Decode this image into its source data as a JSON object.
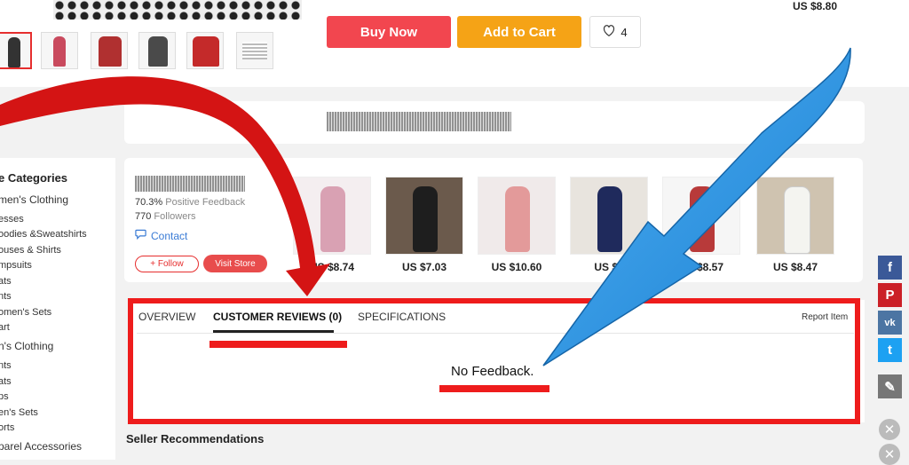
{
  "product": {
    "buy_label": "Buy Now",
    "cart_label": "Add to Cart",
    "wish_count": "4",
    "price_top": "US $8.80"
  },
  "sidebar": {
    "title": "e Categories",
    "groups": [
      {
        "head": "men's Clothing",
        "items": [
          "esses",
          "oodies &Sweatshirts",
          "ouses & Shirts",
          "mpsuits",
          "ats",
          "nts",
          "omen's Sets",
          "art"
        ]
      },
      {
        "head": "n's Clothing",
        "items": [
          "nts",
          "ats",
          "ps",
          "en's Sets",
          "orts"
        ]
      }
    ],
    "last": "parel Accessories"
  },
  "seller": {
    "positive_value": "70.3%",
    "positive_label": "Positive Feedback",
    "followers_value": "770",
    "followers_label": "Followers",
    "contact_label": "Contact",
    "follow_label": "+ Follow",
    "visit_label": "Visit Store"
  },
  "products": [
    {
      "price": "US $8.74",
      "color": "#d9a1b3"
    },
    {
      "price": "US $7.03",
      "color": "#1e1e1e"
    },
    {
      "price": "US $10.60",
      "color": "#e39a9a"
    },
    {
      "price": "US $1",
      "color": "#1f2a5c"
    },
    {
      "price": "US $8.57",
      "color": "#b83a3a"
    },
    {
      "price": "US $8.47",
      "color": "#f4f4f0"
    }
  ],
  "tabs": {
    "overview": "OVERVIEW",
    "reviews": "CUSTOMER REVIEWS (0)",
    "specs": "SPECIFICATIONS",
    "report": "Report Item"
  },
  "feedback": {
    "empty_text": "No Feedback."
  },
  "recommendations": {
    "title": "Seller Recommendations"
  },
  "social": [
    {
      "icon": "facebook-icon",
      "glyph": "f",
      "color": "#3b5998"
    },
    {
      "icon": "pinterest-icon",
      "glyph": "P",
      "color": "#cb2027"
    },
    {
      "icon": "vk-icon",
      "glyph": "vk",
      "color": "#4c75a3"
    },
    {
      "icon": "twitter-icon",
      "glyph": "t",
      "color": "#1da1f2"
    },
    {
      "icon": "edit-icon",
      "glyph": "✎",
      "color": "#777777"
    }
  ],
  "colors": {
    "accent_red": "#ee1c1c",
    "arrow_blue": "#1f8fe0",
    "buy": "#f2464f",
    "cart": "#f5a316"
  }
}
